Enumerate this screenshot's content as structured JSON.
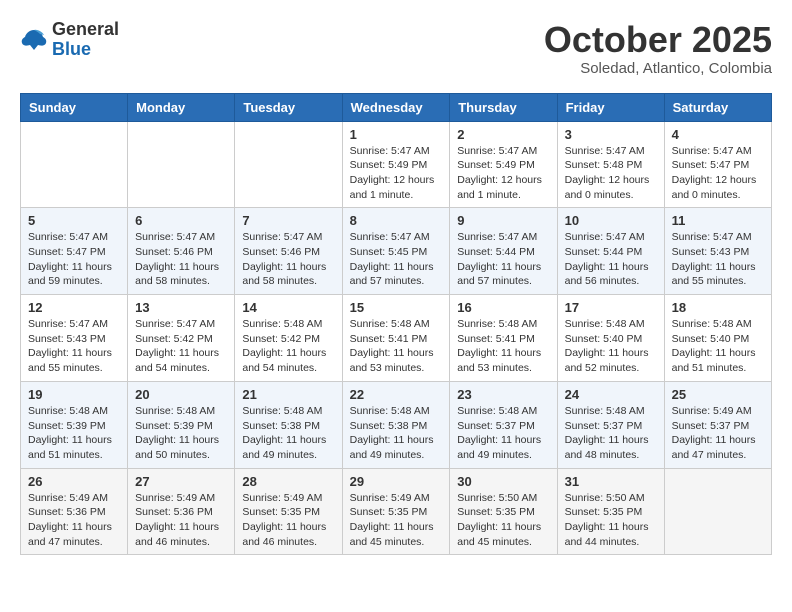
{
  "header": {
    "logo_line1": "General",
    "logo_line2": "Blue",
    "month": "October 2025",
    "location": "Soledad, Atlantico, Colombia"
  },
  "weekdays": [
    "Sunday",
    "Monday",
    "Tuesday",
    "Wednesday",
    "Thursday",
    "Friday",
    "Saturday"
  ],
  "weeks": [
    [
      {
        "day": "",
        "info": ""
      },
      {
        "day": "",
        "info": ""
      },
      {
        "day": "",
        "info": ""
      },
      {
        "day": "1",
        "info": "Sunrise: 5:47 AM\nSunset: 5:49 PM\nDaylight: 12 hours\nand 1 minute."
      },
      {
        "day": "2",
        "info": "Sunrise: 5:47 AM\nSunset: 5:49 PM\nDaylight: 12 hours\nand 1 minute."
      },
      {
        "day": "3",
        "info": "Sunrise: 5:47 AM\nSunset: 5:48 PM\nDaylight: 12 hours\nand 0 minutes."
      },
      {
        "day": "4",
        "info": "Sunrise: 5:47 AM\nSunset: 5:47 PM\nDaylight: 12 hours\nand 0 minutes."
      }
    ],
    [
      {
        "day": "5",
        "info": "Sunrise: 5:47 AM\nSunset: 5:47 PM\nDaylight: 11 hours\nand 59 minutes."
      },
      {
        "day": "6",
        "info": "Sunrise: 5:47 AM\nSunset: 5:46 PM\nDaylight: 11 hours\nand 58 minutes."
      },
      {
        "day": "7",
        "info": "Sunrise: 5:47 AM\nSunset: 5:46 PM\nDaylight: 11 hours\nand 58 minutes."
      },
      {
        "day": "8",
        "info": "Sunrise: 5:47 AM\nSunset: 5:45 PM\nDaylight: 11 hours\nand 57 minutes."
      },
      {
        "day": "9",
        "info": "Sunrise: 5:47 AM\nSunset: 5:44 PM\nDaylight: 11 hours\nand 57 minutes."
      },
      {
        "day": "10",
        "info": "Sunrise: 5:47 AM\nSunset: 5:44 PM\nDaylight: 11 hours\nand 56 minutes."
      },
      {
        "day": "11",
        "info": "Sunrise: 5:47 AM\nSunset: 5:43 PM\nDaylight: 11 hours\nand 55 minutes."
      }
    ],
    [
      {
        "day": "12",
        "info": "Sunrise: 5:47 AM\nSunset: 5:43 PM\nDaylight: 11 hours\nand 55 minutes."
      },
      {
        "day": "13",
        "info": "Sunrise: 5:47 AM\nSunset: 5:42 PM\nDaylight: 11 hours\nand 54 minutes."
      },
      {
        "day": "14",
        "info": "Sunrise: 5:48 AM\nSunset: 5:42 PM\nDaylight: 11 hours\nand 54 minutes."
      },
      {
        "day": "15",
        "info": "Sunrise: 5:48 AM\nSunset: 5:41 PM\nDaylight: 11 hours\nand 53 minutes."
      },
      {
        "day": "16",
        "info": "Sunrise: 5:48 AM\nSunset: 5:41 PM\nDaylight: 11 hours\nand 53 minutes."
      },
      {
        "day": "17",
        "info": "Sunrise: 5:48 AM\nSunset: 5:40 PM\nDaylight: 11 hours\nand 52 minutes."
      },
      {
        "day": "18",
        "info": "Sunrise: 5:48 AM\nSunset: 5:40 PM\nDaylight: 11 hours\nand 51 minutes."
      }
    ],
    [
      {
        "day": "19",
        "info": "Sunrise: 5:48 AM\nSunset: 5:39 PM\nDaylight: 11 hours\nand 51 minutes."
      },
      {
        "day": "20",
        "info": "Sunrise: 5:48 AM\nSunset: 5:39 PM\nDaylight: 11 hours\nand 50 minutes."
      },
      {
        "day": "21",
        "info": "Sunrise: 5:48 AM\nSunset: 5:38 PM\nDaylight: 11 hours\nand 49 minutes."
      },
      {
        "day": "22",
        "info": "Sunrise: 5:48 AM\nSunset: 5:38 PM\nDaylight: 11 hours\nand 49 minutes."
      },
      {
        "day": "23",
        "info": "Sunrise: 5:48 AM\nSunset: 5:37 PM\nDaylight: 11 hours\nand 49 minutes."
      },
      {
        "day": "24",
        "info": "Sunrise: 5:48 AM\nSunset: 5:37 PM\nDaylight: 11 hours\nand 48 minutes."
      },
      {
        "day": "25",
        "info": "Sunrise: 5:49 AM\nSunset: 5:37 PM\nDaylight: 11 hours\nand 47 minutes."
      }
    ],
    [
      {
        "day": "26",
        "info": "Sunrise: 5:49 AM\nSunset: 5:36 PM\nDaylight: 11 hours\nand 47 minutes."
      },
      {
        "day": "27",
        "info": "Sunrise: 5:49 AM\nSunset: 5:36 PM\nDaylight: 11 hours\nand 46 minutes."
      },
      {
        "day": "28",
        "info": "Sunrise: 5:49 AM\nSunset: 5:35 PM\nDaylight: 11 hours\nand 46 minutes."
      },
      {
        "day": "29",
        "info": "Sunrise: 5:49 AM\nSunset: 5:35 PM\nDaylight: 11 hours\nand 45 minutes."
      },
      {
        "day": "30",
        "info": "Sunrise: 5:50 AM\nSunset: 5:35 PM\nDaylight: 11 hours\nand 45 minutes."
      },
      {
        "day": "31",
        "info": "Sunrise: 5:50 AM\nSunset: 5:35 PM\nDaylight: 11 hours\nand 44 minutes."
      },
      {
        "day": "",
        "info": ""
      }
    ]
  ]
}
